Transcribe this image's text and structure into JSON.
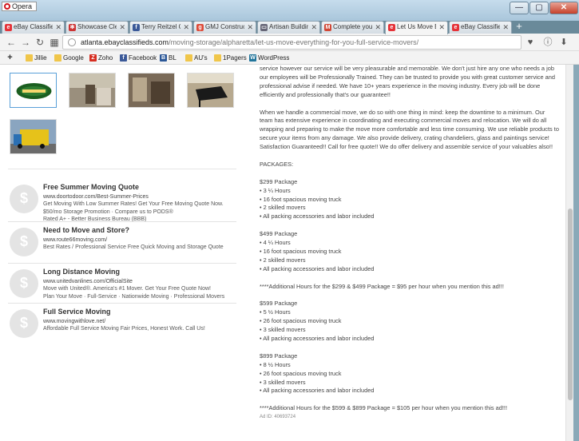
{
  "window": {
    "app_name": "Opera",
    "controls": {
      "minimize": "—",
      "maximize": "▢",
      "close": "✕"
    }
  },
  "tabs": [
    {
      "label": "eBay Classifieds",
      "icon": "e",
      "color": "#e53238"
    },
    {
      "label": "Showcase Cleaning",
      "icon": "✻",
      "color": "#c33"
    },
    {
      "label": "Terry Reitzel Cons",
      "icon": "f",
      "color": "#3b5998"
    },
    {
      "label": "GMJ Construction",
      "icon": "g",
      "color": "#dd4b39"
    },
    {
      "label": "Artisan Building",
      "icon": "▭",
      "color": "#667"
    },
    {
      "label": "Complete your",
      "icon": "M",
      "color": "#d14836"
    },
    {
      "label": "Let Us Move Ev",
      "icon": "e",
      "color": "#e53238",
      "active": true
    },
    {
      "label": "eBay Classifieds",
      "icon": "e",
      "color": "#e53238"
    }
  ],
  "newtab": "+",
  "toolbar": {
    "url_host": "atlanta.ebayclassifieds.com",
    "url_path": "/moving-storage/alpharetta/let-us-move-everything-for-you-full-service-movers/"
  },
  "bookmarks": [
    {
      "label": "",
      "icon": "+"
    },
    {
      "label": "Jillie",
      "icon": ""
    },
    {
      "label": "Google",
      "icon": ""
    },
    {
      "label": "Zoho",
      "icon": "Z"
    },
    {
      "label": "Facebook",
      "icon": "f"
    },
    {
      "label": "BL",
      "icon": "B"
    },
    {
      "label": "AU's",
      "icon": ""
    },
    {
      "label": "1Pagers",
      "icon": ""
    },
    {
      "label": "WordPress",
      "icon": "W"
    }
  ],
  "ads": [
    {
      "title": "Free Summer Moving Quote",
      "url": "www.doortodoor.com/Best-Summer-Prices",
      "desc_lines": [
        "Get Moving With Low Summer Rates! Get Your Free Moving Quote Now.",
        "$50/mo Storage Promotion · Compare us to PODS®",
        "Rated A+ - Better Business Bureau (BBB)"
      ]
    },
    {
      "title": "Need to Move and Store?",
      "url": "www.route66moving.com/",
      "desc_lines": [
        "Best Rates / Professional Service Free Quick Moving and Storage Quote"
      ]
    },
    {
      "title": "Long Distance Moving",
      "url": "www.unitedvanlines.com/OfficialSite",
      "desc_lines": [
        "Move with United®. America's #1 Mover. Get Your Free Quote Now!",
        "Plan Your Move · Full-Service · Nationwide Moving · Professional Movers"
      ]
    },
    {
      "title": "Full Service Moving",
      "url": "www.movingwithlove.net/",
      "desc_lines": [
        "Affordable Full Service Moving Fair Prices, Honest Work. Call Us!"
      ]
    }
  ],
  "listing": {
    "intro": "service however our service will be very pleasurable and memorable. We don't just hire any one who needs a job our employees will be Professionally Trained. They can be trusted to provide you with great customer service and professional advise if needed. We have 10+ years experience in the moving industry. Every job will be done efficiently and professionally that's our guarantee!!",
    "commercial": "When we handle a commercial move, we do so with one thing in mind: keep the downtime to a minimum. Our team has extensive experience in coordinating and executing commercial moves and relocation. We will do all wrapping and preparing to make the move more comfortable and less time consuming. We use reliable products to secure your items from any damage. We also provide delivery, crating chandeliers, glass and paintings service! Satisfaction Guaranteed!! Call for free quote!! We do offer delivery and assemble service of your valuables also!!",
    "packages_heading": "PACKAGES:",
    "packages": [
      {
        "price": "$299 Package",
        "lines": [
          "• 3 ¼ Hours",
          "• 16 foot spacious moving truck",
          "• 2 skilled movers",
          "• All packing accessories and labor included"
        ]
      },
      {
        "price": "$499 Package",
        "lines": [
          "• 4 ¼ Hours",
          "• 16 foot spacious moving truck",
          "• 2 skilled movers",
          "• All packing accessories and labor included"
        ]
      }
    ],
    "note1": "****Additional Hours for the $299 & $499 Package = $95 per hour when you mention this ad!!!",
    "packages2": [
      {
        "price": "$599 Package",
        "lines": [
          "• 5 ½ Hours",
          "• 26 foot spacious moving truck",
          "• 3 skilled movers",
          "• All packing accessories and labor included"
        ]
      },
      {
        "price": "$899 Package",
        "lines": [
          "• 8 ½ Hours",
          "• 26 foot spacious moving truck",
          "• 3 skilled movers",
          "• All packing accessories and labor included"
        ]
      }
    ],
    "note2": "****Additional Hours for the $599 & $899 Package = $105 per hour when you mention this ad!!!",
    "ad_id": "Ad ID: 40693724"
  }
}
